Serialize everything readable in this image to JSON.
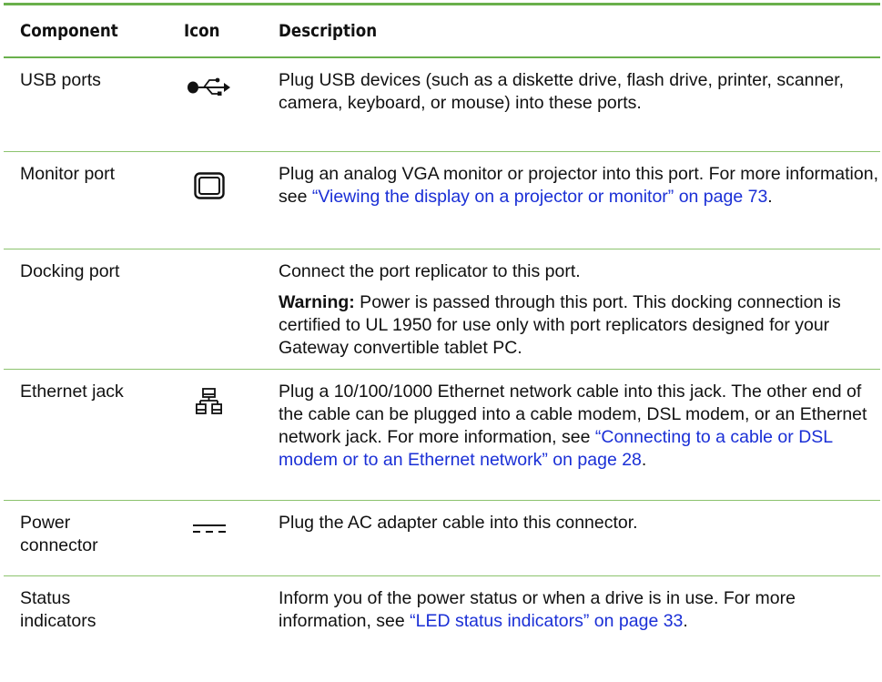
{
  "headers": {
    "component": "Component",
    "icon": "Icon",
    "description": "Description"
  },
  "rows": [
    {
      "component": "USB ports",
      "icon": "usb-icon",
      "desc_text": "Plug USB devices (such as a diskette drive, flash drive, printer, scanner, camera, keyboard, or mouse) into these ports."
    },
    {
      "component": "Monitor port",
      "icon": "monitor-icon",
      "desc_text": "Plug an analog VGA monitor or projector into this port. For more information, see ",
      "desc_link": "“Viewing the display on a projector or monitor” on page 73",
      "desc_end": "."
    },
    {
      "component": "Docking port",
      "icon": "",
      "desc_text": "Connect the port replicator to this port.",
      "warning_label": "Warning:",
      "warning_text": " Power is passed through this port. This docking connection is certified to UL 1950 for use only with port replicators designed for your Gateway convertible tablet PC."
    },
    {
      "component": "Ethernet jack",
      "icon": "network-icon",
      "desc_text": "Plug a 10/100/1000 Ethernet network cable into this jack. The other end of the cable can be plugged into a cable modem, DSL modem, or an Ethernet network jack. For more information, see ",
      "desc_link": "“Connecting to a cable or DSL modem or to an Ethernet network” on page 28",
      "desc_end": "."
    },
    {
      "component": "Power connector",
      "icon": "dc-power-icon",
      "desc_text": "Plug the AC adapter cable into this connector."
    },
    {
      "component": "Status indicators",
      "icon": "",
      "desc_text": "Inform you of the power status or when a drive is in use. For more information, see ",
      "desc_link": "“LED status indicators” on page 33",
      "desc_end": "."
    }
  ],
  "colors": {
    "rule": "#6ab04c",
    "link": "#1a2fd6"
  }
}
